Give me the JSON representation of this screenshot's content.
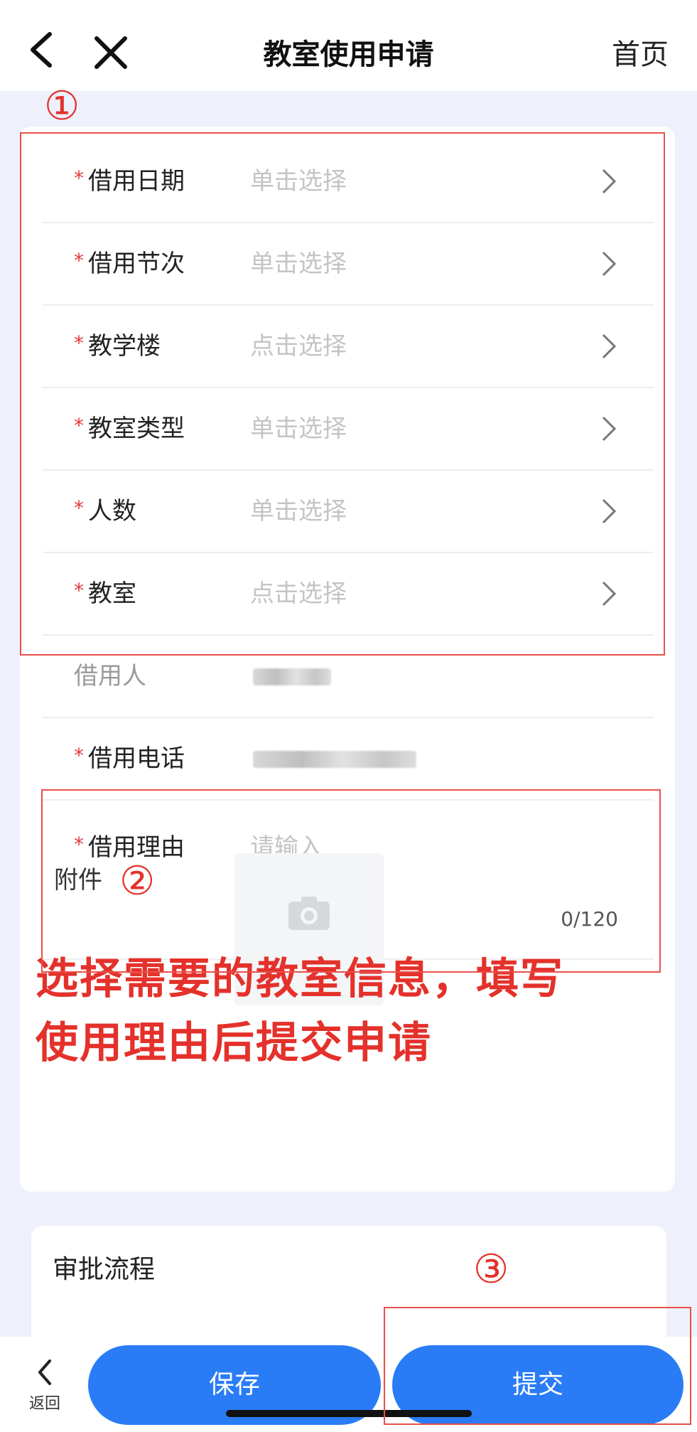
{
  "header": {
    "title": "教室使用申请",
    "home_label": "首页",
    "back_icon": "chevron-left-icon",
    "close_icon": "close-icon"
  },
  "form": {
    "required_mark": "*",
    "rows": [
      {
        "label": "借用日期",
        "placeholder": "单击选择"
      },
      {
        "label": "借用节次",
        "placeholder": "单击选择"
      },
      {
        "label": "教学楼",
        "placeholder": "点击选择"
      },
      {
        "label": "教室类型",
        "placeholder": "单击选择"
      },
      {
        "label": "人数",
        "placeholder": "单击选择"
      },
      {
        "label": "教室",
        "placeholder": "点击选择"
      }
    ],
    "borrower_label": "借用人",
    "phone_label": "借用电话",
    "reason_label": "借用理由",
    "reason_placeholder": "请输入",
    "reason_counter": "0/120",
    "attachment_label": "附件"
  },
  "annotation": {
    "line1": "选择需要的教室信息，填写",
    "line2": "使用理由后提交申请",
    "marker1": "①",
    "marker2": "②",
    "marker3": "③"
  },
  "approval": {
    "title": "审批流程"
  },
  "bottom": {
    "back_label": "返回",
    "save_label": "保存",
    "submit_label": "提交"
  },
  "colors": {
    "primary": "#2a7cf6",
    "required": "#e23a3a",
    "annotation": "#e4312b",
    "background": "#eef0fb"
  }
}
